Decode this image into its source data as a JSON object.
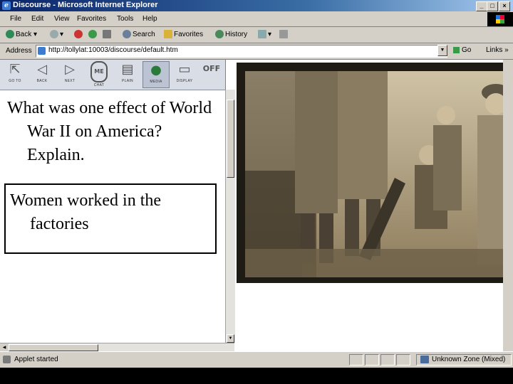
{
  "window": {
    "title": "Discourse - Microsoft Internet Explorer"
  },
  "menu": [
    "File",
    "Edit",
    "View",
    "Favorites",
    "Tools",
    "Help"
  ],
  "toolbar": {
    "back": "Back",
    "search": "Search",
    "favorites": "Favorites",
    "history": "History"
  },
  "address": {
    "label": "Address",
    "url": "http://tollylat:10003/discourse/default.htm",
    "go": "Go",
    "links": "Links"
  },
  "app_toolbar": [
    {
      "label": "GO TO",
      "icon": "goto-icon"
    },
    {
      "label": "BACK",
      "icon": "back-arrow-icon"
    },
    {
      "label": "NEXT",
      "icon": "next-arrow-icon"
    },
    {
      "label": "CHAT",
      "icon": "chat-icon"
    },
    {
      "label": "PLAIN",
      "icon": "plain-icon"
    },
    {
      "label": "MEDIA",
      "icon": "globe-icon"
    },
    {
      "label": "DISPLAY",
      "icon": "display-icon"
    },
    {
      "label": "OFF",
      "icon": "off-icon"
    }
  ],
  "chat_badge": "ME",
  "question": "What was one effect of World War II on America? Explain.",
  "answer": "Women worked in the factories",
  "status": {
    "text": "Applet started",
    "zone": "Unknown Zone (Mixed)"
  }
}
